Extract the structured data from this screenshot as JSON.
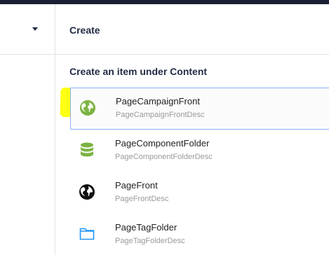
{
  "header": {
    "title": "Create"
  },
  "section": {
    "title": "Create an item under Content"
  },
  "items": [
    {
      "name": "PageCampaignFront",
      "desc": "PageCampaignFrontDesc",
      "icon": "globe-icon-green"
    },
    {
      "name": "PageComponentFolder",
      "desc": "PageComponentFolderDesc",
      "icon": "database-icon"
    },
    {
      "name": "PageFront",
      "desc": "PageFrontDesc",
      "icon": "globe-icon-black"
    },
    {
      "name": "PageTagFolder",
      "desc": "PageTagFolderDesc",
      "icon": "folder-icon"
    }
  ],
  "colors": {
    "accent_green": "#7cb342",
    "selected_border": "#8fb0ff",
    "highlight": "#ffff00",
    "folder_blue": "#2196f3"
  }
}
